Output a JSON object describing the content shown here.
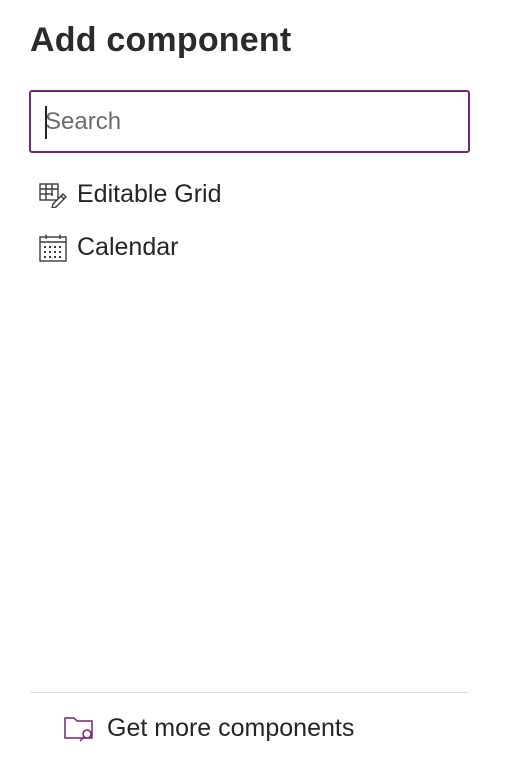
{
  "panel": {
    "title": "Add component"
  },
  "search": {
    "placeholder": "Search",
    "value": ""
  },
  "components": [
    {
      "label": "Editable Grid",
      "icon": "editable-grid-icon"
    },
    {
      "label": "Calendar",
      "icon": "calendar-icon"
    }
  ],
  "footer": {
    "link_label": "Get more components",
    "icon": "folder-search-icon"
  },
  "colors": {
    "accent": "#742774",
    "text": "#252525",
    "divider": "#e1dfdd"
  }
}
